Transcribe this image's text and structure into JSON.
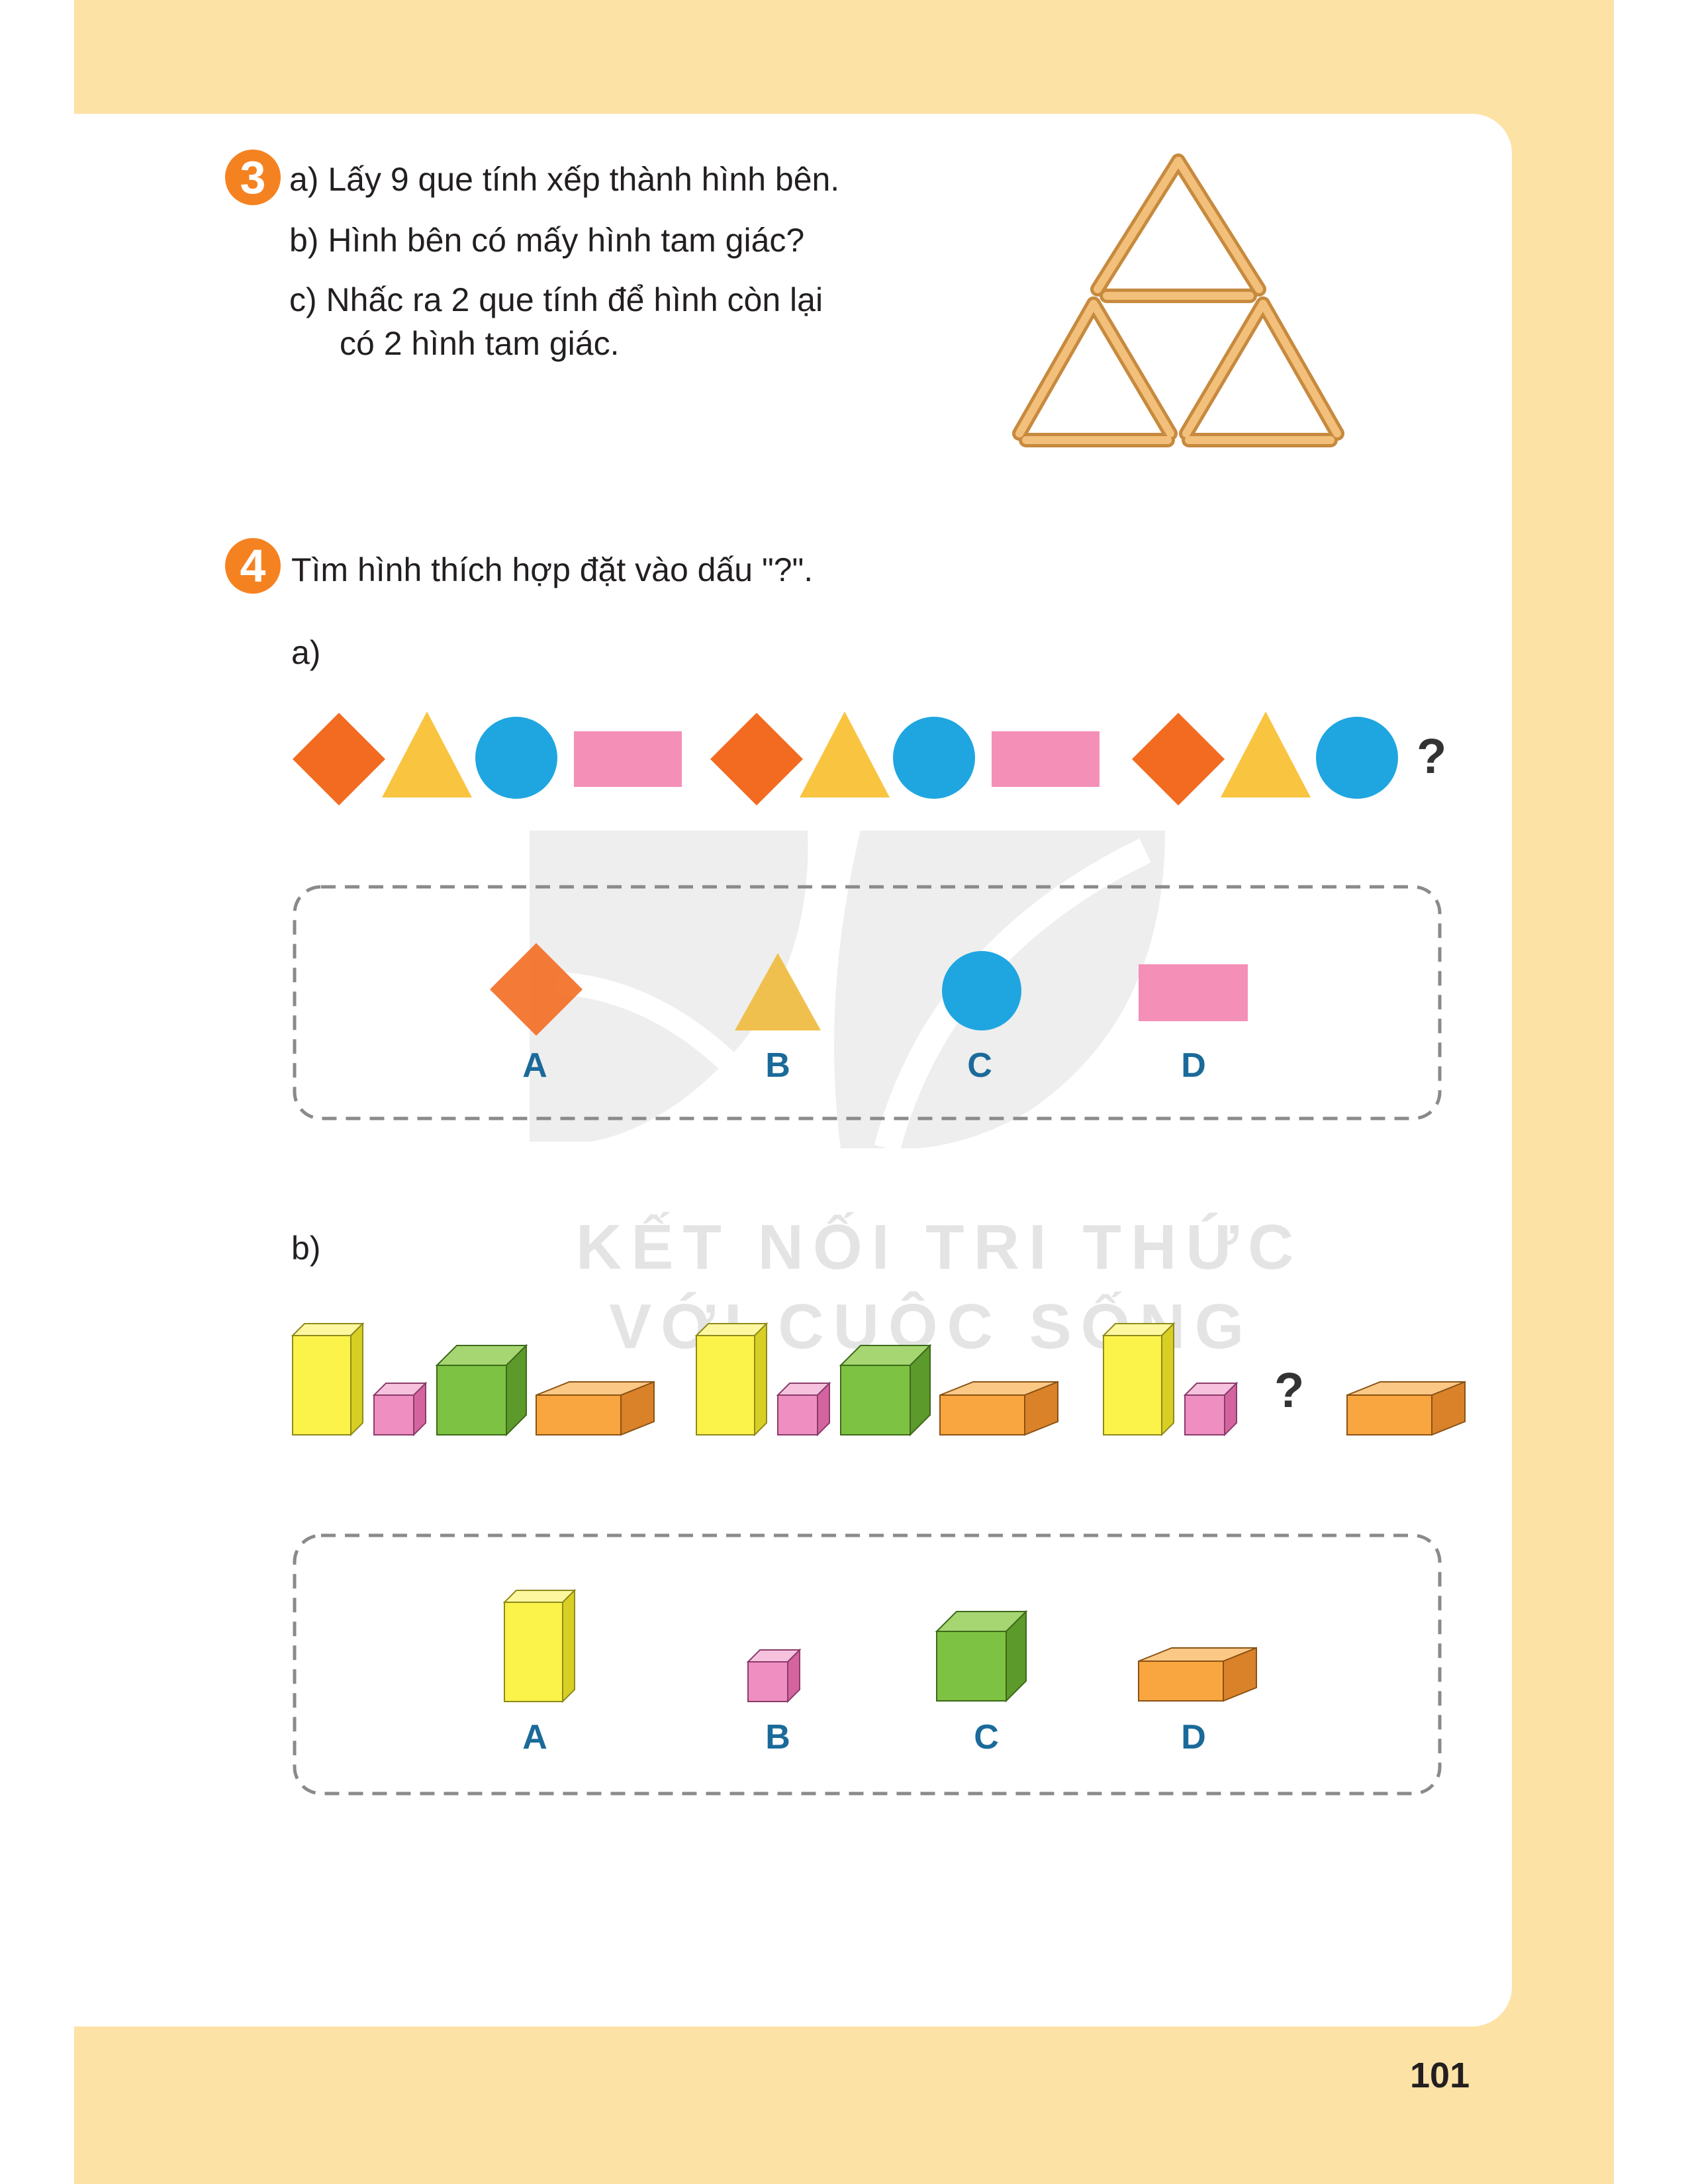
{
  "page": {
    "number": "101",
    "colors": {
      "frame": "#fde2a6",
      "orange": "#f26b21",
      "yellow": "#f9c440",
      "blue": "#1fa6e1",
      "pink": "#f48fb8",
      "label_blue": "#1a6a9a",
      "badge": "#f58220"
    }
  },
  "exercise3": {
    "number": "3",
    "line_a": "a) Lấy 9 que tính xếp thành hình bên.",
    "line_b": "b)  Hình bên có mấy hình tam giác?",
    "line_c1": "c)  Nhấc ra 2 que tính để hình còn lại",
    "line_c2": "có 2 hình tam giác.",
    "figure": "matchstick-triangles-icon"
  },
  "exercise4": {
    "number": "4",
    "instruction": "Tìm hình thích hợp đặt vào dấu \"?\".",
    "part_a": {
      "label": "a)",
      "sequence": [
        "diamond",
        "triangle",
        "circle",
        "rectangle",
        "diamond",
        "triangle",
        "circle",
        "rectangle",
        "diamond",
        "triangle",
        "circle"
      ],
      "question_mark": "?",
      "options": [
        {
          "label": "A",
          "shape": "diamond"
        },
        {
          "label": "B",
          "shape": "triangle"
        },
        {
          "label": "C",
          "shape": "circle"
        },
        {
          "label": "D",
          "shape": "rectangle"
        }
      ]
    },
    "part_b": {
      "label": "b)",
      "sequence": [
        "yellow-prism",
        "pink-cube",
        "green-cube",
        "orange-box",
        "yellow-prism",
        "pink-cube",
        "green-cube",
        "orange-box",
        "yellow-prism",
        "pink-cube"
      ],
      "question_mark": "?",
      "after_question": "orange-box",
      "options": [
        {
          "label": "A",
          "shape": "yellow-prism"
        },
        {
          "label": "B",
          "shape": "pink-cube"
        },
        {
          "label": "C",
          "shape": "green-cube"
        },
        {
          "label": "D",
          "shape": "orange-box"
        }
      ]
    }
  },
  "watermark": {
    "line1": "KẾT NỐI TRI THỨC",
    "line2": "VỚI CUỘC SỐNG",
    "icon": "leaf-logo-icon"
  }
}
